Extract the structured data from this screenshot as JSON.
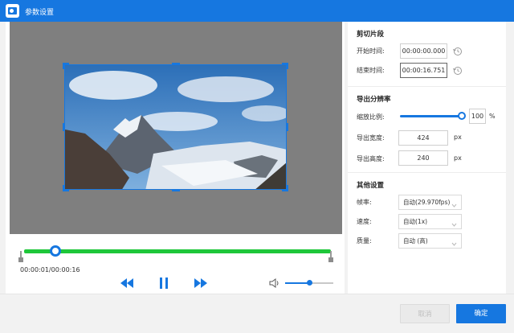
{
  "window": {
    "title": "参数设置",
    "icon": "video-camera-icon"
  },
  "player": {
    "time_display": "00:00:01/00:00:16",
    "playhead_fraction": 0.0625,
    "volume_fraction": 0.5
  },
  "clip": {
    "section_title": "剪切片段",
    "start_label": "开始时间:",
    "start_value": "00:00:00.000",
    "end_label": "结束时间:",
    "end_value": "00:00:16.751"
  },
  "resolution": {
    "section_title": "导出分辨率",
    "scale_label": "缩放比例:",
    "scale_value": "100",
    "scale_unit": "%",
    "width_label": "导出宽度:",
    "width_value": "424",
    "height_label": "导出高度:",
    "height_value": "240",
    "px_unit": "px"
  },
  "other": {
    "section_title": "其他设置",
    "fps_label": "帧率:",
    "fps_value": "自动(29.970fps)",
    "speed_label": "速度:",
    "speed_value": "自动(1x)",
    "quality_label": "质量:",
    "quality_value": "自动 (高)"
  },
  "footer": {
    "cancel_label": "取消",
    "ok_label": "确定"
  },
  "colors": {
    "accent": "#1677e0",
    "timeline": "#1fc73a",
    "preview_bg": "#7f7f7f"
  }
}
